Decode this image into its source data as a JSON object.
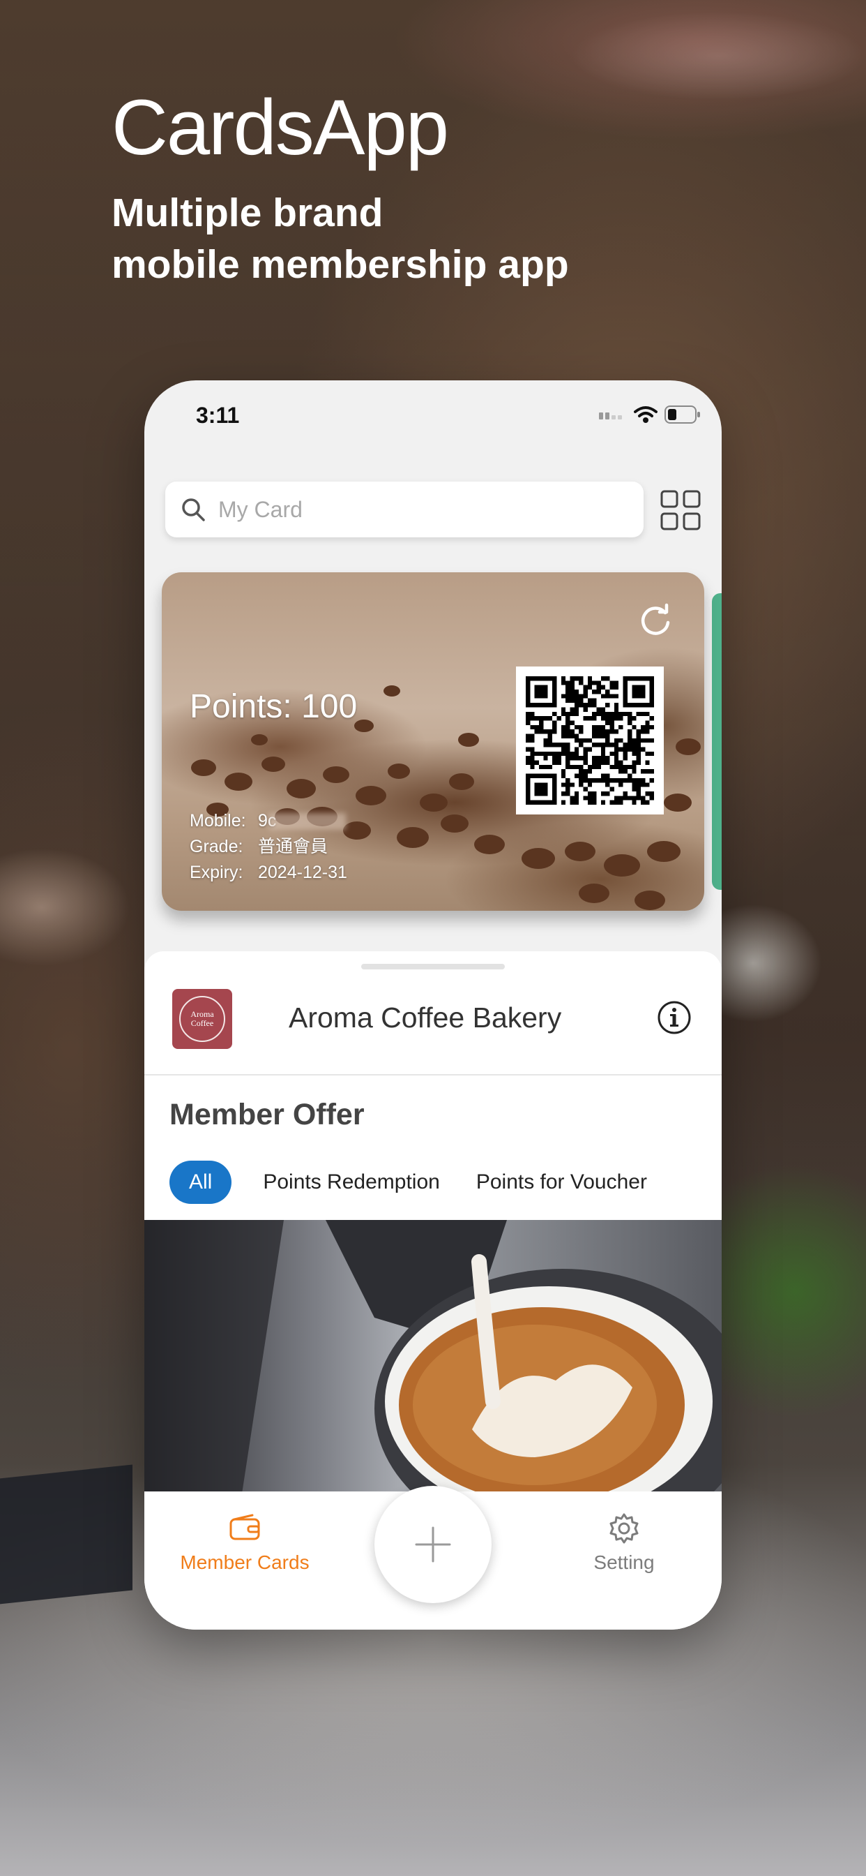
{
  "hero": {
    "title": "CardsApp",
    "tagline_line1": "Multiple brand",
    "tagline_line2": "mobile membership app"
  },
  "status_bar": {
    "time": "3:11"
  },
  "search": {
    "placeholder": "My Card"
  },
  "card": {
    "points_text": "Points: 100",
    "mobile_label": "Mobile:",
    "mobile_value": "9с",
    "grade_label": "Grade:",
    "grade_value": "普通會員",
    "expiry_label": "Expiry:",
    "expiry_value": "2024-12-31"
  },
  "brand": {
    "name": "Aroma Coffee Bakery",
    "logo_line1": "Aroma",
    "logo_line2": "Coffee"
  },
  "offers": {
    "title": "Member Offer",
    "tabs": [
      "All",
      "Points Redemption",
      "Points for Voucher"
    ]
  },
  "tabbar": {
    "member_cards": "Member Cards",
    "setting": "Setting"
  },
  "colors": {
    "accent_orange": "#f07d1a",
    "tab_active_blue": "#1976c8",
    "brand_logo_red": "#a5464e",
    "next_card_green": "#4fb18b"
  },
  "icons": [
    "search-icon",
    "grid-icon",
    "refresh-icon",
    "info-icon",
    "wallet-icon",
    "plus-icon",
    "gear-icon",
    "signal-icon",
    "wifi-icon",
    "battery-icon"
  ]
}
